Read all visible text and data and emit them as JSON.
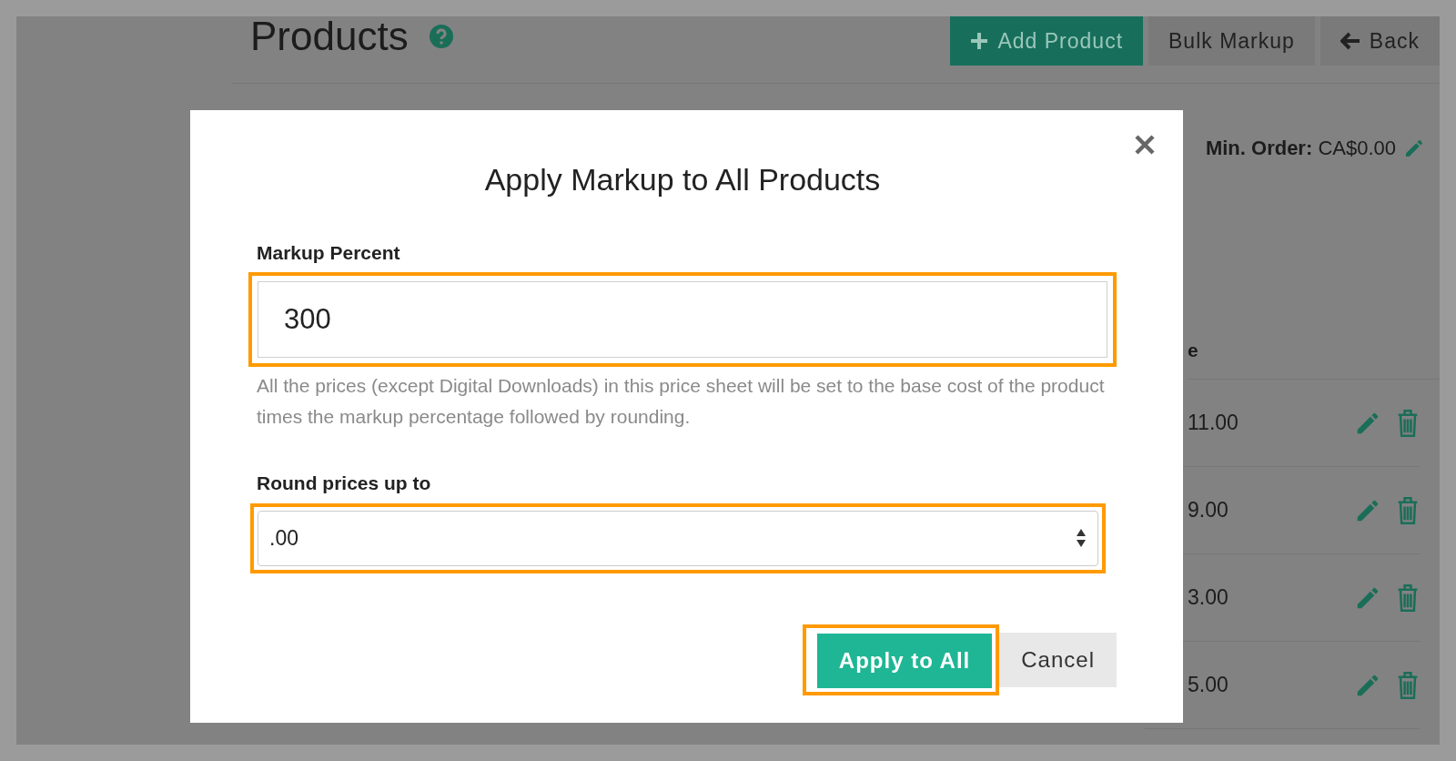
{
  "page": {
    "title": "Products",
    "actions": [
      {
        "label": "Add Product",
        "kind": "primary"
      },
      {
        "label": "Bulk Markup",
        "kind": "secondary"
      },
      {
        "label": "Back",
        "kind": "secondary"
      }
    ],
    "min_order": {
      "label": "Min. Order:",
      "value": "CA$0.00"
    },
    "table": {
      "column_fragment": "e",
      "rows": [
        {
          "price": "11.00"
        },
        {
          "price": "9.00"
        },
        {
          "price": "3.00"
        },
        {
          "price": "5.00"
        }
      ]
    }
  },
  "modal": {
    "title": "Apply Markup to All Products",
    "fields": [
      {
        "kind": "input",
        "label": "Markup Percent",
        "value": "300",
        "highlighted": true,
        "help": "All the prices (except Digital Downloads) in this price sheet will be set to the base cost of the product times the markup percentage followed by rounding."
      },
      {
        "kind": "select",
        "label": "Round prices up to",
        "value": ".00",
        "highlighted": true
      }
    ],
    "buttons": [
      {
        "label": "Apply to All",
        "kind": "primary",
        "highlighted": true
      },
      {
        "label": "Cancel",
        "kind": "secondary",
        "highlighted": false
      }
    ]
  }
}
